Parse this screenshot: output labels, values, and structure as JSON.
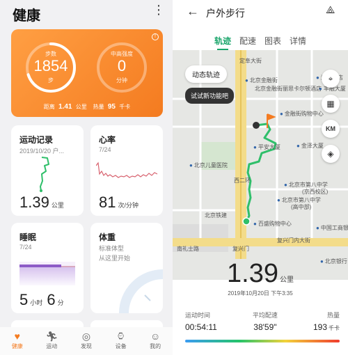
{
  "left": {
    "header": {
      "title": "健康",
      "more_icon": "more-vertical-icon"
    },
    "summary": {
      "steps": {
        "label": "步数",
        "value": "1854",
        "unit": "步",
        "progress": 0.7
      },
      "intensity": {
        "label": "中高强度",
        "value": "0",
        "unit": "分钟",
        "progress": 0.0
      },
      "distance_label": "距离",
      "distance_value": "1.41",
      "distance_unit": "公里",
      "calorie_label": "热量",
      "calorie_value": "95",
      "calorie_unit": "千卡",
      "info_icon": "info-icon"
    },
    "exercise": {
      "title": "运动记录",
      "subtitle": "2019/10/20 户...",
      "value": "1.39",
      "unit": "公里"
    },
    "heart": {
      "title": "心率",
      "subtitle": "7/24",
      "value": "81",
      "unit": "次/分钟"
    },
    "sleep": {
      "title": "睡眠",
      "subtitle": "7/24",
      "hours": "5",
      "hours_unit": "小时",
      "minutes": "6",
      "minutes_unit": "分"
    },
    "weight": {
      "title": "体重",
      "line1": "标准体型",
      "line2": "从这里开始"
    },
    "nav": [
      {
        "label": "健康",
        "icon": "heart-icon",
        "active": true
      },
      {
        "label": "运动",
        "icon": "running-icon",
        "active": false
      },
      {
        "label": "发现",
        "icon": "discover-icon",
        "active": false
      },
      {
        "label": "设备",
        "icon": "watch-icon",
        "active": false
      },
      {
        "label": "我的",
        "icon": "user-icon",
        "active": false
      }
    ]
  },
  "right": {
    "header": {
      "title": "户外步行",
      "back_icon": "back-arrow-icon",
      "share_icon": "share-icon"
    },
    "tabs": [
      "轨迹",
      "配速",
      "图表",
      "详情"
    ],
    "active_tab": "轨迹",
    "map": {
      "animate_button": "动态轨迹",
      "try_tip": "试试新功能吧",
      "labels": {
        "l1": "定阜大街",
        "l2": "北京金融街",
        "l3": "洲际酒店",
        "l4": "北京金融街丽思卡尔顿酒店",
        "l5": "北京儿童医院",
        "l6": "金融街购物中心",
        "l7": "金泽大厦",
        "l8": "平安大厦",
        "l9": "北京市第八中学",
        "l10": "(京西校区)",
        "l11": "北京市第八中学",
        "l12": "(高中部)",
        "l13": "北京铁建",
        "l14": "中国工商银行",
        "l15": "百盛购物中心",
        "l16": "复兴门内大街",
        "l17": "南礼士路",
        "l18": "复兴门",
        "l19": "西二环",
        "l20": "丰融大厦",
        "l21": "北京银行"
      },
      "controls": [
        "locate-icon",
        "map-icon",
        "KM",
        "layers-icon"
      ]
    },
    "distance": {
      "value": "1.39",
      "unit": "公里"
    },
    "date": "2019年10月20日 下午3:35",
    "stats": {
      "time_label": "运动时间",
      "time_value": "00:54:11",
      "pace_label": "平均配速",
      "pace_value": "38'59\"",
      "cal_label": "热量",
      "cal_value": "193",
      "cal_unit": "千卡"
    },
    "colors": {
      "accent": "#1aa56b",
      "orange": "#f47b20"
    }
  }
}
